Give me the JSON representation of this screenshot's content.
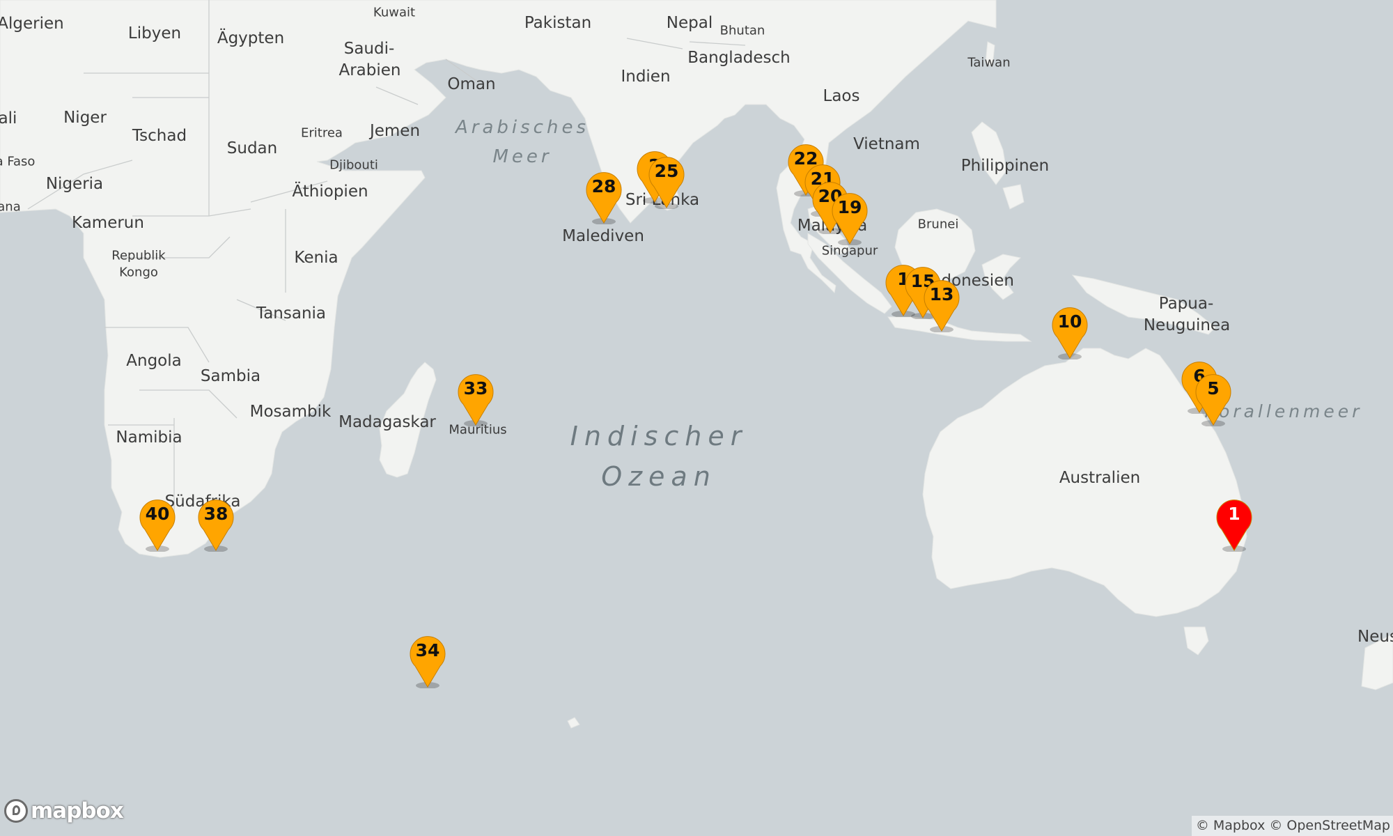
{
  "map": {
    "colors": {
      "water": "#ccd3d7",
      "land": "#f2f3f1",
      "border": "#c9cccc",
      "marker_orange": "#ffa500",
      "marker_red": "#ff0000"
    },
    "ocean_label": {
      "line1": "Indischer",
      "line2": "Ozean"
    },
    "sea_label": {
      "line1": "Arabisches",
      "line2": "Meer"
    },
    "coral_sea_label": "Korallenmeer",
    "countries": [
      "Algerien",
      "Libyen",
      "Ägypten",
      "Saudi-",
      "Arabien",
      "Pakistan",
      "Nepal",
      "Bhutan",
      "Bangladesch",
      "Indien",
      "Oman",
      "Jemen",
      "Eritrea",
      "Djibouti",
      "Sudan",
      "Tschad",
      "Niger",
      "ali",
      "a Faso",
      "Nigeria",
      "ana",
      "Kamerun",
      "Republik",
      "Kongo",
      "Äthiopien",
      "Kenia",
      "Tansania",
      "Angola",
      "Sambia",
      "Mosambik",
      "Madagaskar",
      "Namibia",
      "Südafrika",
      "Sri Lanka",
      "Malediven",
      "Laos",
      "Vietnam",
      "Philippinen",
      "Taiwan",
      "Malaysia",
      "Brunei",
      "Indonesien",
      "Papua-",
      "Neuguinea",
      "Australien",
      "Neus",
      "Kuwait"
    ],
    "cities": [
      "Singapur",
      "Mauritius"
    ]
  },
  "markers": [
    "40",
    "38",
    "34",
    "33",
    "28",
    "2",
    "25",
    "22",
    "21",
    "20",
    "19",
    "1",
    "15",
    "13",
    "10",
    "6",
    "5",
    "1"
  ],
  "logo": "mapbox",
  "attribution": "© Mapbox © OpenStreetMap"
}
